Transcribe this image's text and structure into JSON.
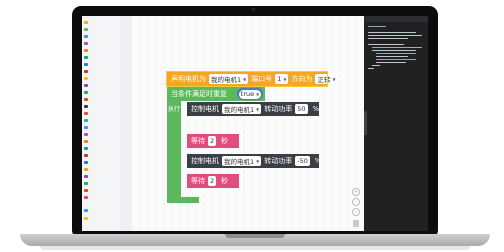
{
  "blocks": {
    "declare": {
      "prefix": "声明电机为",
      "motor": "我的电机1",
      "port_label": "端口号",
      "port_value": "1",
      "direction_label": "方向为",
      "direction_value": "正转"
    },
    "loop": {
      "label": "当条件满足时重复",
      "condition": "true",
      "do_label": "执行"
    },
    "motor_cmd_1": {
      "label": "控制电机",
      "motor": "我的电机1",
      "power_label": "转动功率",
      "power": "50",
      "unit": "%"
    },
    "wait_1": {
      "label": "等待",
      "seconds": "2",
      "unit": "秒"
    },
    "motor_cmd_2": {
      "label": "控制电机",
      "motor": "我的电机1",
      "power_label": "转动功率",
      "power": "-50",
      "unit": "%"
    },
    "wait_2": {
      "label": "等待",
      "seconds": "2",
      "unit": "秒"
    }
  },
  "workspace_controls": {
    "zoom_in_icon": "plus-icon",
    "zoom_out_icon": "minus-icon",
    "trash_icon": "trash-icon"
  },
  "colors": {
    "declare_block": "#f5a623",
    "loop_block": "#5cb85c",
    "motor_block": "#3a3e45",
    "wait_block": "#e04e80",
    "code_panel_bg": "#1f2123"
  }
}
